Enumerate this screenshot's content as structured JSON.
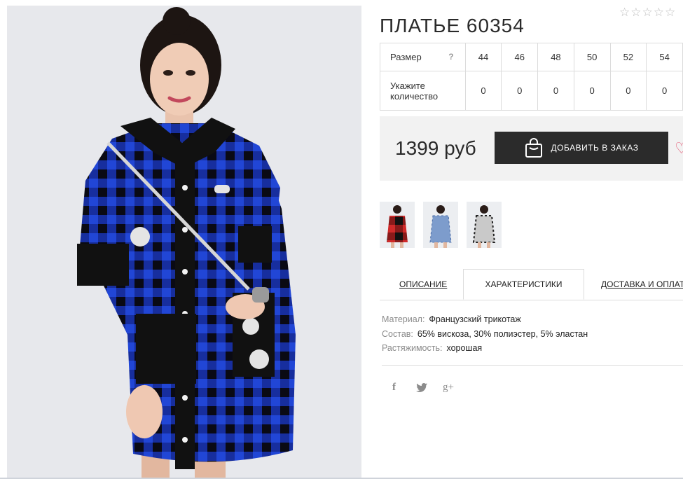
{
  "product": {
    "title": "ПЛАТЬЕ 60354",
    "rating_stars": "☆☆☆☆☆"
  },
  "size_table": {
    "size_label": "Размер",
    "help_icon": "?",
    "sizes": [
      "44",
      "46",
      "48",
      "50",
      "52",
      "54"
    ],
    "quantity_label_line1": "Укажите",
    "quantity_label_line2": "количество",
    "quantities": [
      "0",
      "0",
      "0",
      "0",
      "0",
      "0"
    ]
  },
  "purchase": {
    "price": "1399 руб",
    "add_to_cart_label": "ДОБАВИТЬ В ЗАКАЗ",
    "heart_icon": "♡"
  },
  "thumbnails": [
    {
      "name": "red-variant",
      "color": "#c62a2a"
    },
    {
      "name": "light-blue-variant",
      "color": "#7b98c8"
    },
    {
      "name": "black-white-variant",
      "color": "#3a3a3a"
    }
  ],
  "tabs": [
    {
      "label": "ОПИСАНИЕ",
      "active": false
    },
    {
      "label": "ХАРАКТЕРИСТИКИ",
      "active": true
    },
    {
      "label": "ДОСТАВКА И ОПЛАТА",
      "active": false
    }
  ],
  "specs": [
    {
      "key": "Материал:",
      "value": "Французский трикотаж"
    },
    {
      "key": "Состав:",
      "value": "65% вискоза, 30% полиэстер, 5% эластан"
    },
    {
      "key": "Растяжимость:",
      "value": "хорошая"
    }
  ],
  "social": {
    "facebook": "f",
    "twitter": "🐦",
    "google_plus": "g+"
  },
  "colors": {
    "dress_blue": "#1f3fd0",
    "dress_black": "#111111",
    "button_dark": "#2b2b2b",
    "panel_gray": "#f2f2f2"
  }
}
